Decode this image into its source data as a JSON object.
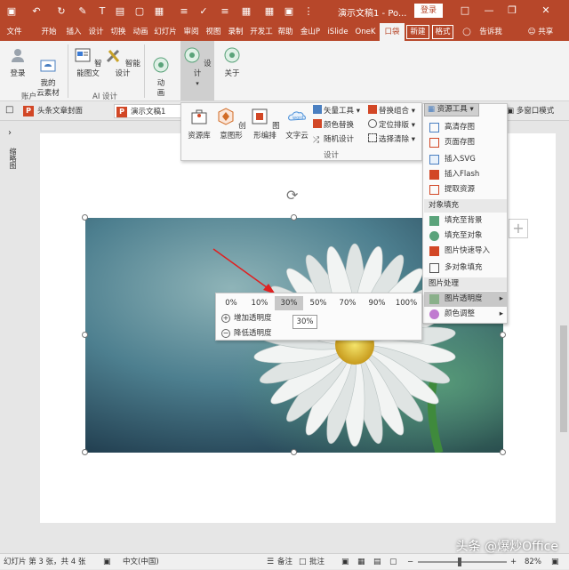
{
  "titlebar": {
    "doc_title": "演示文稿1  -  Po...",
    "login": "登录"
  },
  "tabs": [
    "文件",
    "开始",
    "插入",
    "设计",
    "切换",
    "动画",
    "幻灯片",
    "审阅",
    "视图",
    "录制",
    "开发工",
    "帮助",
    "金山P",
    "iSlide",
    "OneK",
    "口袋",
    "新建",
    "格式"
  ],
  "tabs_extra": {
    "lightbulb": "告诉我",
    "share": "共享"
  },
  "ribbon": {
    "login": "登录",
    "my_material": "我的\n云素材",
    "group_account": "账户",
    "smart_graphic": "智能图文",
    "smart_design": "智能设计",
    "group_ai": "AI 设计",
    "anim": "动\n画",
    "design": "设计",
    "about": "关于"
  },
  "doctabs": {
    "tab1": "头条文章封面",
    "tab2": "演示文稿1",
    "multiwin": "多窗口模式"
  },
  "dropdown": {
    "res_lib": "资源库",
    "creative": "创意图形",
    "layout": "图形编排",
    "wordcloud": "文字云",
    "vector": "矢量工具",
    "color_swap": "颜色替换",
    "random_design": "随机设计",
    "replace_combo": "替换组合",
    "locate_layout": "定位排版",
    "select_clear": "选择清除",
    "group_label": "设计"
  },
  "resmenu": {
    "header": "资源工具",
    "items": [
      {
        "label": "高清存图"
      },
      {
        "label": "页面存图"
      },
      {
        "label": "插入SVG"
      },
      {
        "label": "插入Flash"
      },
      {
        "label": "提取资源"
      }
    ],
    "section_fill": "对象填充",
    "fill_items": [
      {
        "label": "填充至背景"
      },
      {
        "label": "填充至对象"
      },
      {
        "label": "图片快速导入"
      },
      {
        "label": "多对象填充"
      }
    ],
    "section_pic": "图片处理",
    "pic_items": [
      {
        "label": "图片透明度"
      },
      {
        "label": "颜色调整"
      }
    ]
  },
  "transparency": {
    "options": [
      "0%",
      "10%",
      "30%",
      "50%",
      "70%",
      "90%",
      "100%"
    ],
    "selected": "30%",
    "increase": "增加透明度",
    "decrease": "降低透明度",
    "tooltip": "30%"
  },
  "leftpane": {
    "label": "缩略图"
  },
  "statusbar": {
    "slide_info": "幻灯片 第 3 张，共 4 张",
    "lang": "中文(中国)",
    "notes": "备注",
    "comments": "批注",
    "zoom": "82%"
  },
  "watermark": "头条 @爆炒Office",
  "colors": {
    "accent": "#b7472a",
    "ribbon_bg": "#f3f3f3"
  }
}
